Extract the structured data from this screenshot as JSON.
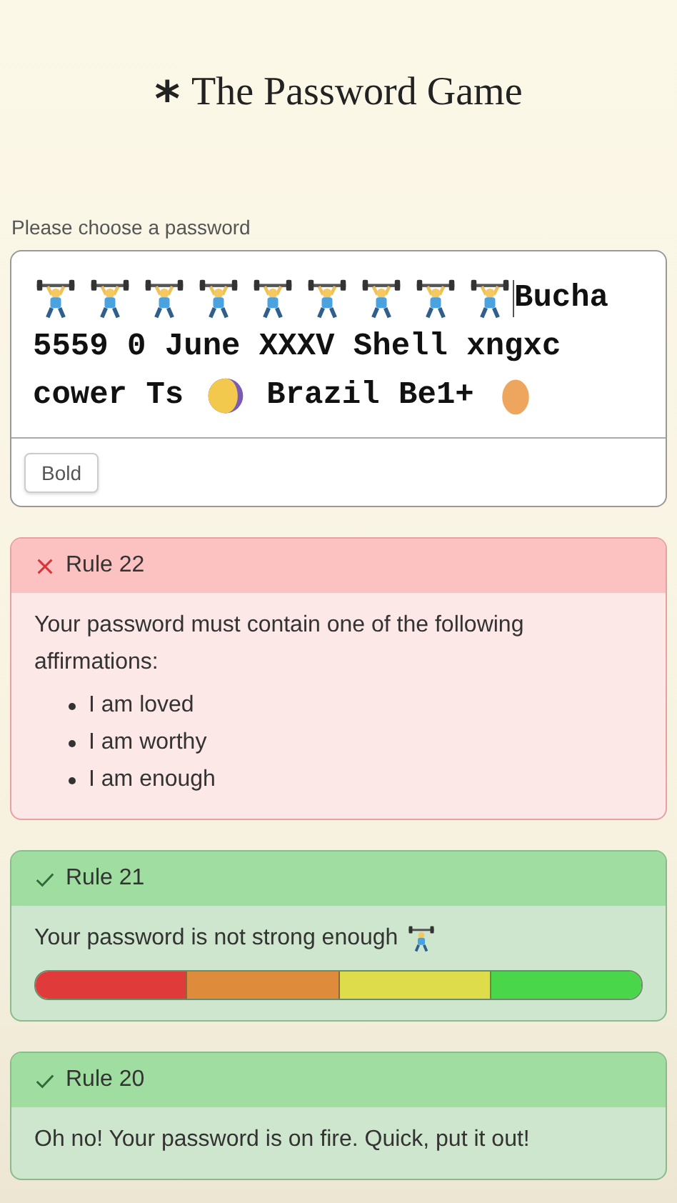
{
  "title": {
    "mark": "*",
    "text": "The Password Game"
  },
  "password": {
    "label": "Please choose a password",
    "lines": [
      [
        {
          "kind": "lifter"
        },
        {
          "kind": "lifter"
        },
        {
          "kind": "lifter"
        },
        {
          "kind": "lifter"
        },
        {
          "kind": "lifter"
        },
        {
          "kind": "lifter"
        },
        {
          "kind": "lifter"
        },
        {
          "kind": "lifter"
        },
        {
          "kind": "lifter"
        },
        {
          "kind": "caret"
        },
        {
          "kind": "text",
          "text": "Bucha"
        }
      ],
      [
        {
          "kind": "text",
          "text": "5559 0 June XXXV Shell xngxc"
        }
      ],
      [
        {
          "kind": "text",
          "text": "cower Ts"
        },
        {
          "kind": "moon"
        },
        {
          "kind": "text",
          "text": "Brazil Be1+"
        },
        {
          "kind": "egg"
        }
      ]
    ],
    "toolbar": [
      "Bold"
    ]
  },
  "rules": [
    {
      "title": "Rule 22",
      "passed": false,
      "kind": "list",
      "text": "Your password must contain one of the following affirmations:",
      "items": [
        "I am loved",
        "I am worthy",
        "I am enough"
      ]
    },
    {
      "title": "Rule 21",
      "passed": true,
      "kind": "meter",
      "text": "Your password is not strong enough"
    },
    {
      "title": "Rule 20",
      "passed": true,
      "kind": "plain",
      "text": "Oh no! Your password is on fire. Quick, put it out!"
    }
  ]
}
